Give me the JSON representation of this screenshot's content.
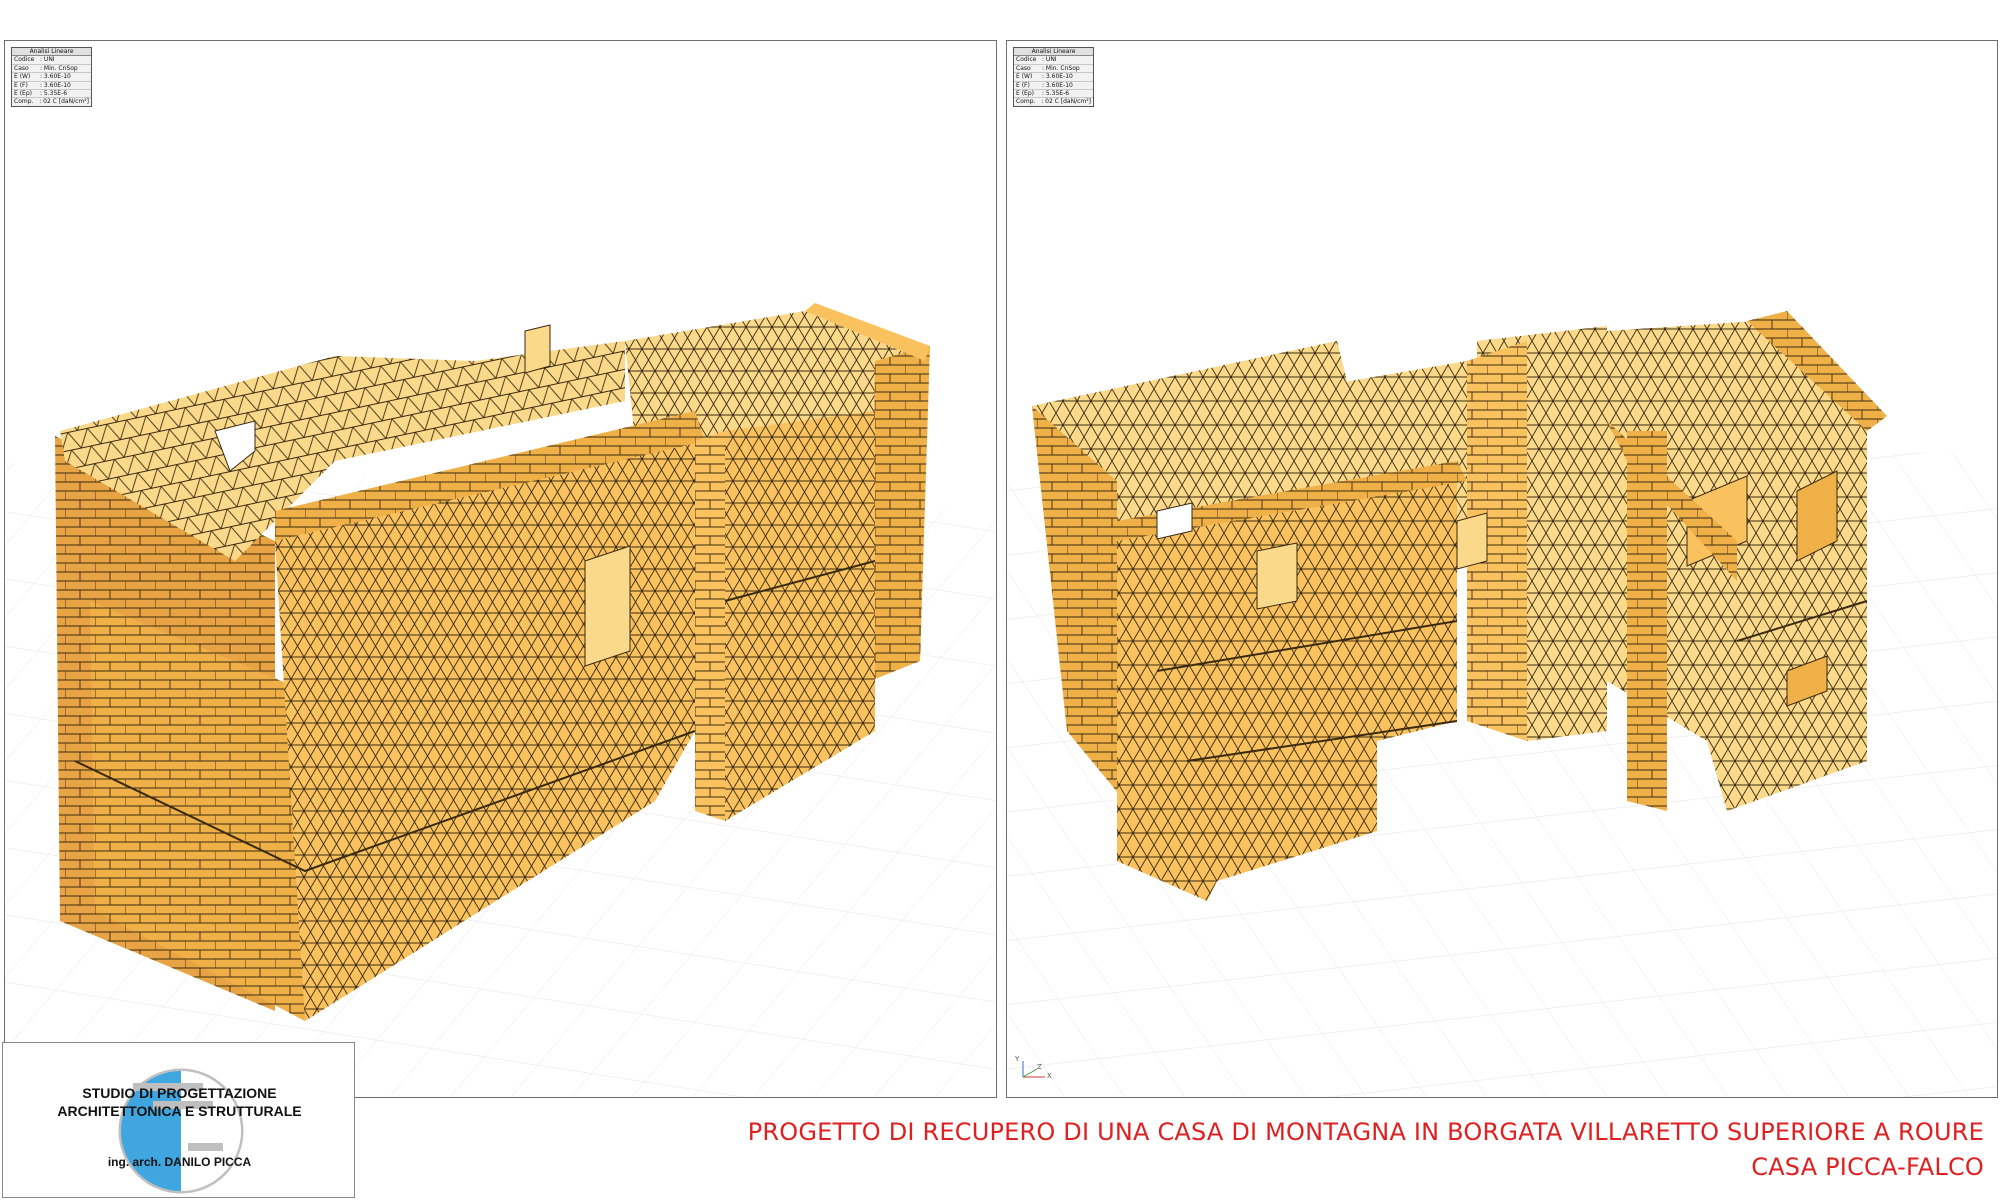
{
  "viewports": {
    "left": {
      "legend": {
        "title": "Analisi Lineare",
        "rows": [
          {
            "key": "Codice",
            "value": ": UNI"
          },
          {
            "key": "Caso",
            "value": ": Min. CnSop"
          },
          {
            "key": "E (W)",
            "value": ": 3.60E-10"
          },
          {
            "key": "E (F)",
            "value": ": 3.60E-10"
          },
          {
            "key": "E (Ep)",
            "value": ": 5.35E-6"
          },
          {
            "key": "Comp.",
            "value": ": 02 C [daN/cm²]"
          }
        ]
      }
    },
    "right": {
      "legend": {
        "title": "Analisi Lineare",
        "rows": [
          {
            "key": "Codice",
            "value": ": UNI"
          },
          {
            "key": "Caso",
            "value": ": Min. CnSop"
          },
          {
            "key": "E (W)",
            "value": ": 3.60E-10"
          },
          {
            "key": "E (F)",
            "value": ": 3.60E-10"
          },
          {
            "key": "E (Ep)",
            "value": ": 5.35E-6"
          },
          {
            "key": "Comp.",
            "value": ": 02 C [daN/cm²]"
          }
        ]
      },
      "axis_labels": {
        "y": "Y",
        "z": "Z",
        "x": "X"
      }
    }
  },
  "logo": {
    "line1": "STUDIO DI PROGETTAZIONE",
    "line2": "ARCHITETTONICA E STRUTTURALE",
    "line3": "ing. arch. DANILO PICCA"
  },
  "caption": {
    "line1": "PROGETTO DI RECUPERO DI UNA CASA DI MONTAGNA IN BORGATA VILLARETTO SUPERIORE A ROURE",
    "line2": "CASA PICCA-FALCO"
  },
  "colors": {
    "mesh_fill": "#f9c25e",
    "mesh_fill_light": "#fbd98a",
    "mesh_fill_dark": "#e8a444",
    "mesh_line": "#3a2a10",
    "caption_text": "#e02020",
    "logo_blue": "#3fa6e0"
  }
}
